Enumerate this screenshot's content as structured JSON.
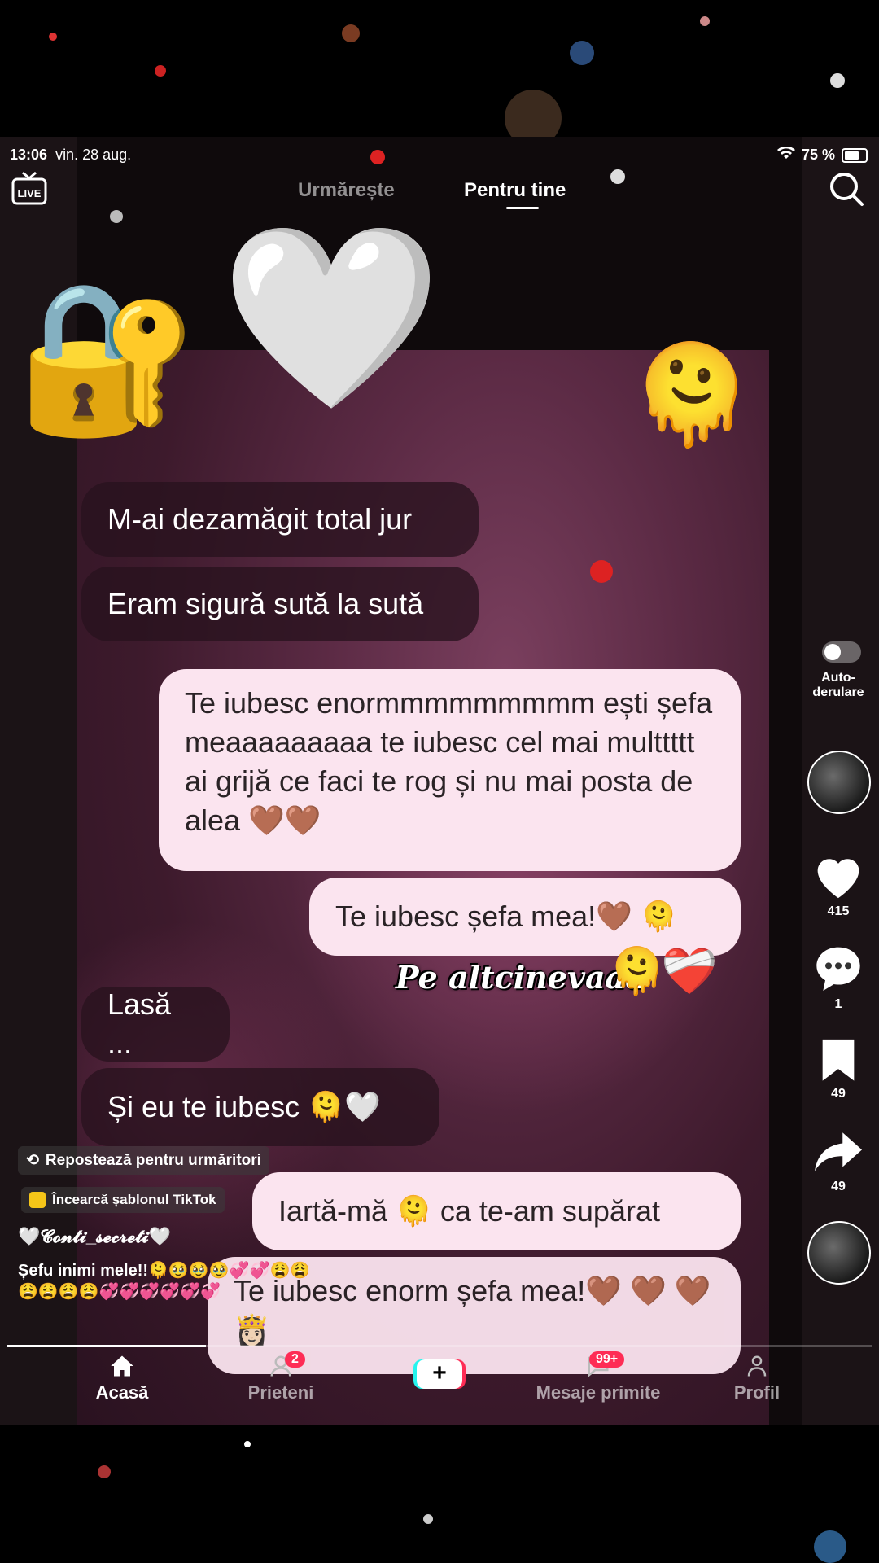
{
  "status": {
    "time": "13:06",
    "date": "vin. 28 aug.",
    "battery": "75 %"
  },
  "nav": {
    "following": "Urmărește",
    "for_you": "Pentru tine",
    "live_icon": "live-tv-icon",
    "search_icon": "search-icon"
  },
  "messages": [
    {
      "side": "received",
      "text": "M-ai dezamăgit total jur"
    },
    {
      "side": "received",
      "text": "Eram sigură sută la sută"
    },
    {
      "side": "sent",
      "text": "Te iubesc enormmmmmmmmm ești șefa meaaaaaaaaa te iubesc cel mai multtttt ai grijă ce faci te rog și nu mai posta de alea 🤎🤎"
    },
    {
      "side": "sent",
      "text": "Te iubesc șefa mea!🤎 🫠"
    },
    {
      "side": "received",
      "text": "Lasă ..."
    },
    {
      "side": "received",
      "text": "Și eu te iubesc 🫠🤍"
    },
    {
      "side": "sent",
      "text": "Iartă-mă 🫠 ca te-am supărat"
    },
    {
      "side": "sent",
      "text": "Te iubesc enorm șefa mea!🤎 🤎 🤎 👸🏻"
    }
  ],
  "sticker_text": "Pe altcinevaaa",
  "stickers": {
    "lock_key": "🔐",
    "white_heart": "🤍",
    "melting_face": "🫠",
    "mending_heart": "❤️‍🩹"
  },
  "rail": {
    "autoscroll_label": "Auto-\nderulare",
    "likes": "415",
    "comments": "1",
    "bookmarks": "49",
    "shares": "49"
  },
  "info": {
    "repost": "Repostează pentru urmăritori",
    "template": "Încearcă șablonul TikTok",
    "username": "🤍𝓒𝓸𝓷𝓽𝓲_𝓼𝓮𝓬𝓻𝓮𝓽𝓲🤍",
    "caption_line1": "Șefu inimi mele!!🫠🥹🥹🥹💞💞😩😩",
    "caption_line2": "😩😩😩😩💞💞💞💞💞💞"
  },
  "tabbar": {
    "home": "Acasă",
    "friends": "Prieteni",
    "friends_badge": "2",
    "create": "+",
    "inbox": "Mesaje primite",
    "inbox_badge": "99+",
    "profile": "Profil"
  },
  "colors": {
    "accent_red": "#fe2c55",
    "accent_cyan": "#25f4ee",
    "bubble_light": "#fbe4ef"
  }
}
